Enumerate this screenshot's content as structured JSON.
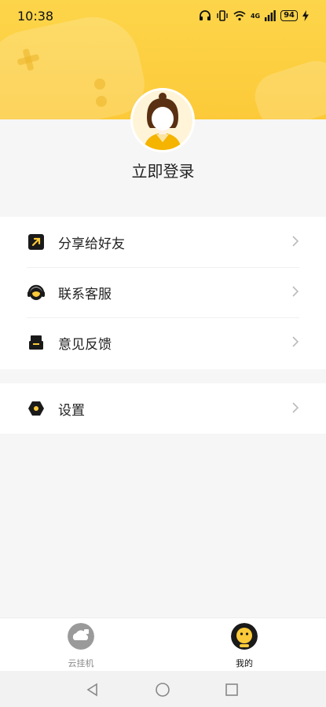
{
  "status_bar": {
    "time": "10:38",
    "network": "4G",
    "battery": "94"
  },
  "profile": {
    "login_label": "立即登录"
  },
  "menu": {
    "share_label": "分享给好友",
    "service_label": "联系客服",
    "feedback_label": "意见反馈",
    "settings_label": "设置"
  },
  "bottom_nav": {
    "cloud_label": "云挂机",
    "mine_label": "我的"
  },
  "colors": {
    "accent": "#fcca39",
    "background": "#f6f6f6",
    "text": "#222222"
  },
  "icons": {
    "share": "share-arrow-icon",
    "service": "headset-icon",
    "feedback": "feedback-icon",
    "settings": "hexagon-settings-icon",
    "cloud": "cloud-icon",
    "mine": "face-icon"
  }
}
